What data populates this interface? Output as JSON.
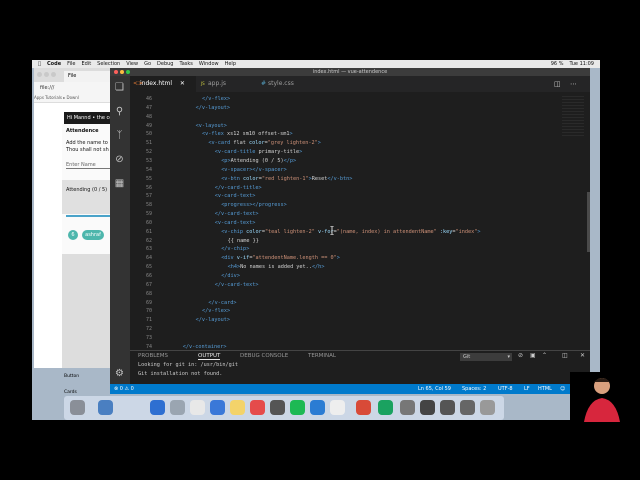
{
  "menubar": {
    "app": "Code",
    "items": [
      "File",
      "Edit",
      "Selection",
      "View",
      "Go",
      "Debug",
      "Tasks",
      "Window",
      "Help"
    ],
    "battery": "96 %",
    "clock": "Tue 11:09"
  },
  "browser": {
    "tab_label": "File",
    "address": "file:///",
    "bookmarks": "Apps   Tutorials ▸ Downl",
    "app_title": "Hi Mannd • the co",
    "card": {
      "heading": "Attendence",
      "line1": "Add the name to",
      "line2": "Thou shall not sh",
      "input_placeholder": "Enter Name",
      "attending_label": "Attending (0 / 5)",
      "chip1": "6",
      "chip2": "ashraf",
      "footer1": "Button",
      "footer2": "Cards"
    }
  },
  "vscode": {
    "window_title": "index.html — vue-attendence",
    "tabs": [
      {
        "label": "index.html",
        "icon": "<>",
        "close": "✕"
      },
      {
        "label": "app.js",
        "icon": "JS"
      },
      {
        "label": "style.css",
        "icon": "#"
      }
    ],
    "code_lines": [
      {
        "n": "46",
        "indent": 10,
        "text": "</v-flex>"
      },
      {
        "n": "47",
        "indent": 8,
        "text": "</v-layout>"
      },
      {
        "n": "48",
        "indent": 0,
        "text": ""
      },
      {
        "n": "49",
        "indent": 8,
        "text": "<v-layout>"
      },
      {
        "n": "50",
        "indent": 10,
        "text": "<v-flex xs12 sm10 offset-sm1>"
      },
      {
        "n": "51",
        "indent": 12,
        "text": "<v-card flat color=\"grey lighten-2\">"
      },
      {
        "n": "52",
        "indent": 14,
        "text": "<v-card-title primary-title>"
      },
      {
        "n": "53",
        "indent": 16,
        "text": "<p>Attending (0 / 5)</p>"
      },
      {
        "n": "54",
        "indent": 16,
        "text": "<v-spacer></v-spacer>"
      },
      {
        "n": "55",
        "indent": 16,
        "text": "<v-btn color=\"red lighten-1\">Reset</v-btn>"
      },
      {
        "n": "56",
        "indent": 14,
        "text": "</v-card-title>"
      },
      {
        "n": "57",
        "indent": 14,
        "text": "<v-card-text>"
      },
      {
        "n": "58",
        "indent": 16,
        "text": "<progress></progress>"
      },
      {
        "n": "59",
        "indent": 14,
        "text": "</v-card-text>"
      },
      {
        "n": "60",
        "indent": 14,
        "text": "<v-card-text>"
      },
      {
        "n": "61",
        "indent": 16,
        "text": "<v-chip color=\"teal lighten-2\" v-for=\"(name, index) in attendentName\" :key=\"index\">"
      },
      {
        "n": "62",
        "indent": 18,
        "text": "{{ name }}"
      },
      {
        "n": "63",
        "indent": 16,
        "text": "</v-chip>"
      },
      {
        "n": "64",
        "indent": 16,
        "text": "<div v-if=\"attendentName.length == 0\">"
      },
      {
        "n": "65",
        "indent": 18,
        "text": "<h4>No names is added yet..</h>"
      },
      {
        "n": "66",
        "indent": 16,
        "text": "</div>"
      },
      {
        "n": "67",
        "indent": 14,
        "text": "</v-card-text>"
      },
      {
        "n": "68",
        "indent": 0,
        "text": ""
      },
      {
        "n": "69",
        "indent": 12,
        "text": "</v-card>"
      },
      {
        "n": "70",
        "indent": 10,
        "text": "</v-flex>"
      },
      {
        "n": "71",
        "indent": 8,
        "text": "</v-layout>"
      },
      {
        "n": "72",
        "indent": 0,
        "text": ""
      },
      {
        "n": "73",
        "indent": 0,
        "text": ""
      },
      {
        "n": "74",
        "indent": 4,
        "text": "</v-container>"
      }
    ],
    "panel": {
      "tabs": [
        "PROBLEMS",
        "OUTPUT",
        "DEBUG CONSOLE",
        "TERMINAL"
      ],
      "active_tab": "OUTPUT",
      "channel": "Git",
      "output": [
        "Looking for git in: /usr/bin/git",
        "Git installation not found."
      ]
    },
    "status": {
      "errors": "⊗ 0  ⚠ 0",
      "position": "Ln 65, Col 59",
      "spaces": "Spaces: 2",
      "encoding": "UTF-8",
      "eol": "LF",
      "language": "HTML"
    },
    "accent": "#007acc"
  }
}
